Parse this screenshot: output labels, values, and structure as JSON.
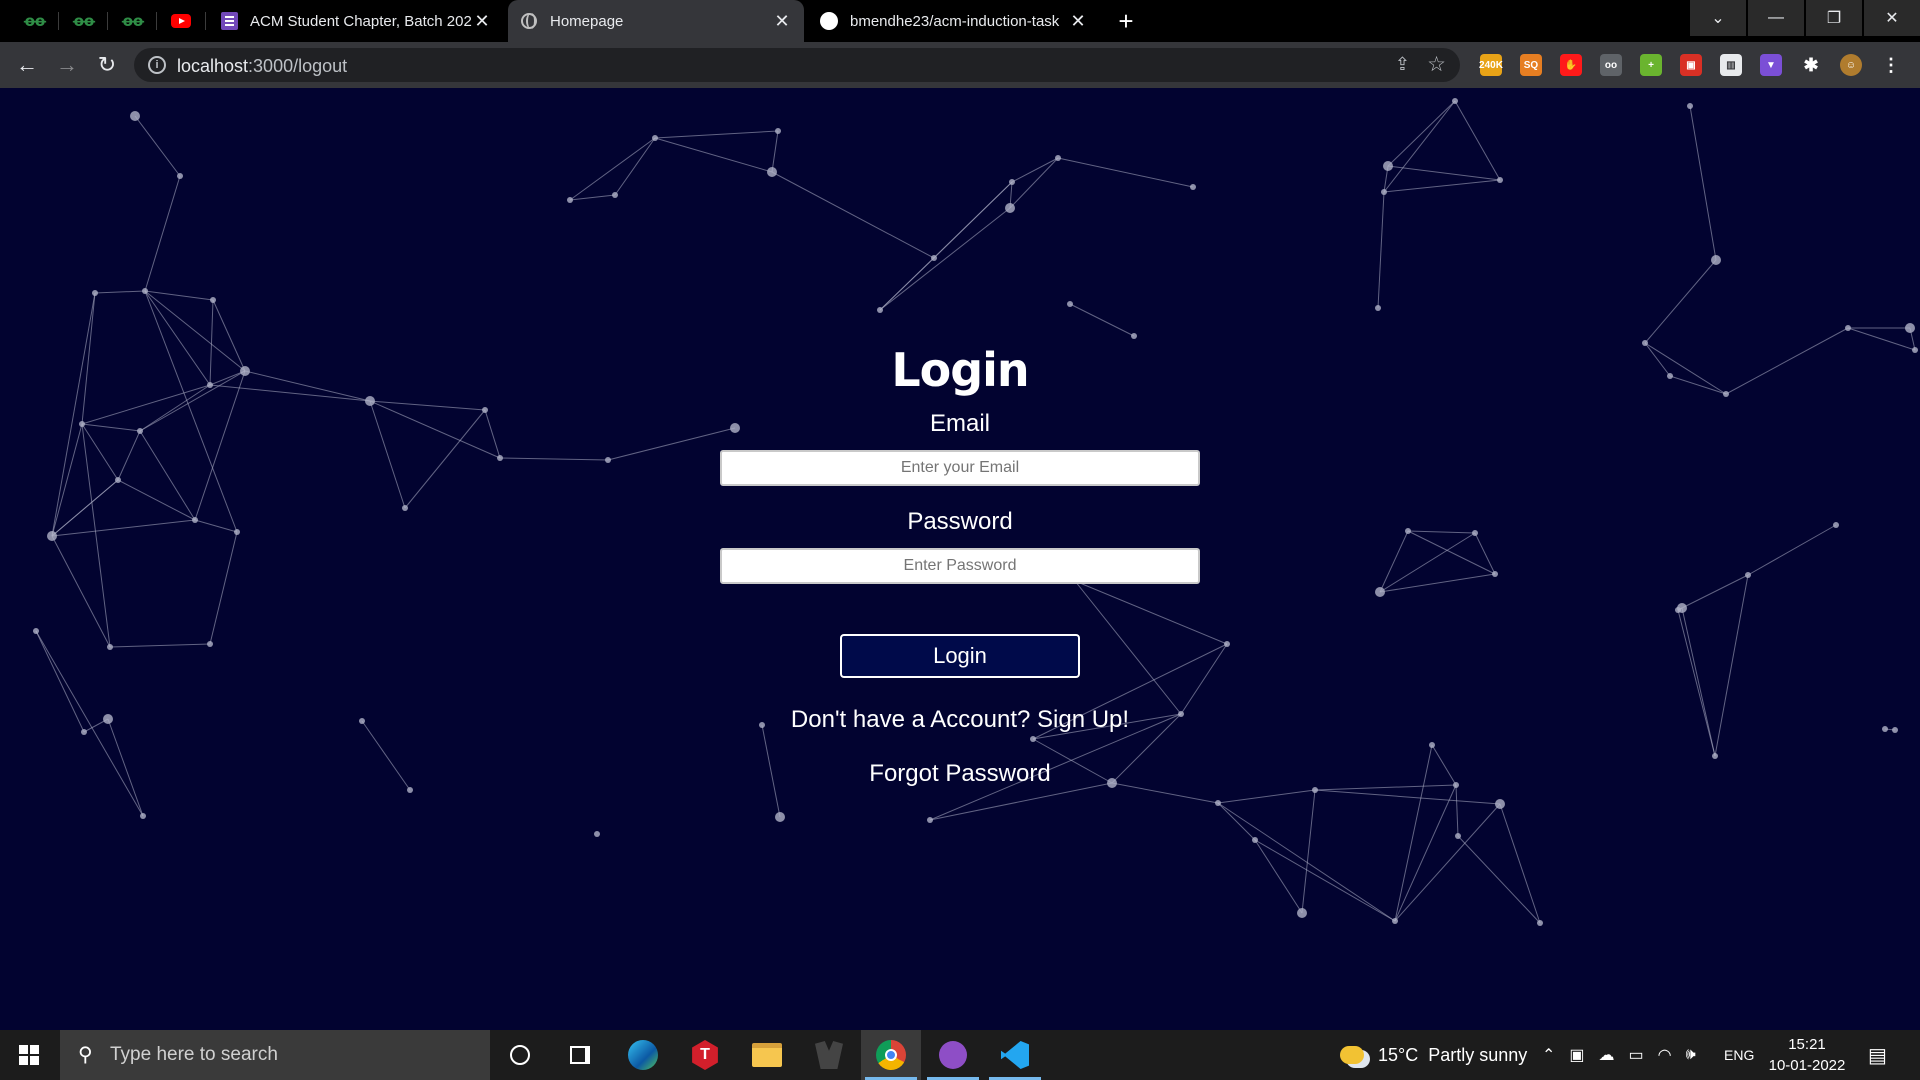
{
  "browser": {
    "pinned_tabs": [
      {
        "icon": "geeksforgeeks-icon",
        "glyph": "ꝋꝋ"
      },
      {
        "icon": "geeksforgeeks-icon",
        "glyph": "ꝋꝋ"
      },
      {
        "icon": "geeksforgeeks-icon",
        "glyph": "ꝋꝋ"
      },
      {
        "icon": "youtube-icon"
      }
    ],
    "tabs": [
      {
        "title": "ACM Student Chapter, Batch 202",
        "icon": "google-forms-icon",
        "close": "✕"
      },
      {
        "title": "Homepage",
        "icon": "globe-icon",
        "close": "✕",
        "active": true
      },
      {
        "title": "bmendhe23/acm-induction-task",
        "icon": "github-icon",
        "close": "✕"
      }
    ],
    "new_tab": "+",
    "window_controls": {
      "tab_search": "⌄",
      "minimize": "—",
      "restore": "❐",
      "close": "✕"
    },
    "nav": {
      "back": "←",
      "forward": "→",
      "reload": "↻"
    },
    "address": {
      "host": "localhost",
      "path": ":3000/logout",
      "info": "i",
      "share": "⇪",
      "star": "☆"
    },
    "extensions": [
      {
        "name": "240k-extension-icon",
        "label": "240K",
        "color": "#e8a317"
      },
      {
        "name": "sq-extension-icon",
        "label": "SQ",
        "color": "#e67e22"
      },
      {
        "name": "red-extension-icon",
        "label": "✋",
        "color": "#ff1a1a"
      },
      {
        "name": "glasses-extension-icon",
        "label": "oo",
        "color": "#5f6368"
      },
      {
        "name": "green-plus-extension-icon",
        "label": "+",
        "color": "#6ab42f"
      },
      {
        "name": "red-box-extension-icon",
        "label": "▣",
        "color": "#d93025"
      },
      {
        "name": "chart-extension-icon",
        "label": "▥",
        "color": "#e8eaed"
      },
      {
        "name": "purple-extension-icon",
        "label": "▼",
        "color": "#7b4fd6"
      },
      {
        "name": "puzzle-extension-icon",
        "label": "✱",
        "color": "#35363a"
      },
      {
        "name": "profile-avatar-icon",
        "label": "☺",
        "color": "#b07c2e"
      },
      {
        "name": "menu-kebab-icon",
        "label": "⋮",
        "color": "#35363a"
      }
    ]
  },
  "page": {
    "title": "Login",
    "email_label": "Email",
    "email_placeholder": "Enter your Email",
    "password_label": "Password",
    "password_placeholder": "Enter Password",
    "login_button": "Login",
    "signup_link": "Don't have a Account? Sign Up!",
    "forgot_link": "Forgot Password",
    "particle_color": "#b0b3c8"
  },
  "taskbar": {
    "search_placeholder": "Type here to search",
    "weather_temp": "15°C",
    "weather_desc": "Partly sunny",
    "language": "ENG",
    "time": "15:21",
    "date": "10-01-2022"
  }
}
